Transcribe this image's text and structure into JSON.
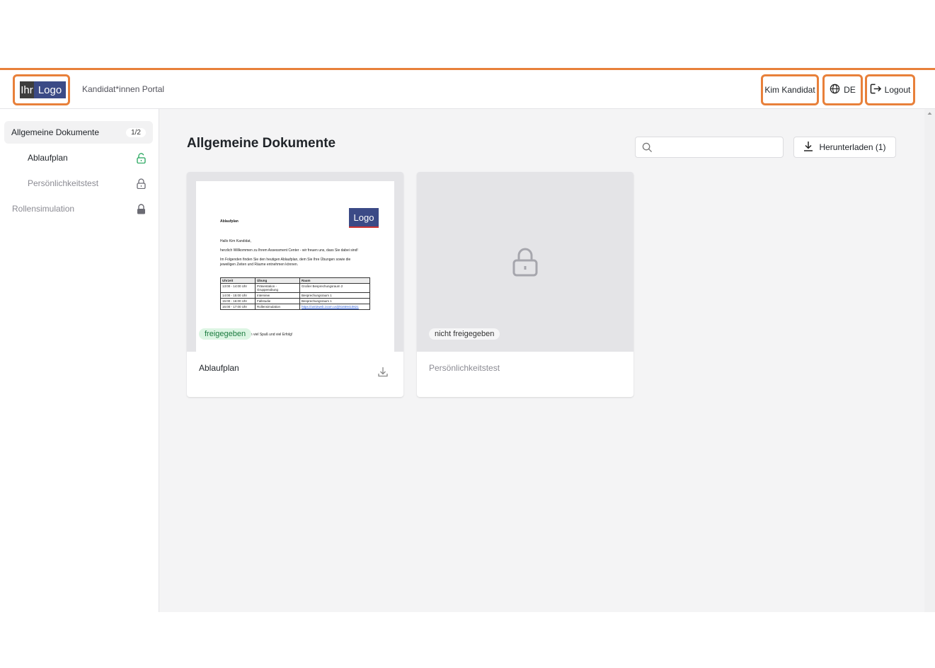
{
  "header": {
    "logo_part1": "Ihr",
    "logo_part2": "Logo",
    "portal_title": "Kandidat*innen Portal",
    "user_name": "Kim Kandidat",
    "language": "DE",
    "logout_label": "Logout"
  },
  "sidebar": {
    "items": [
      {
        "label": "Allgemeine Dokumente",
        "count": "1/2"
      },
      {
        "label": "Ablaufplan"
      },
      {
        "label": "Persönlichkeitstest"
      },
      {
        "label": "Rollensimulation"
      }
    ]
  },
  "main": {
    "title": "Allgemeine Dokumente",
    "search_value": "",
    "download_label": "Herunterladen (1)"
  },
  "cards": [
    {
      "title": "Ablaufplan",
      "status": "freigegeben",
      "preview": {
        "heading": "Ablaufplan",
        "logo": "Logo",
        "greeting": "Hallo Kim Kandidat,",
        "line1": "herzlich Willkommen zu Ihrem Assessment Center - wir freuen uns, dass Sie dabei sind!",
        "line2": "Im Folgenden finden Sie den heutigen Ablaufplan, dem Sie Ihre Übungen sowie die jeweiligen Zeiten und Räume entnehmen können.",
        "columns": [
          "Uhrzeit",
          "Übung",
          "Raum"
        ],
        "rows": [
          [
            "13:00 - 14:00 Uhr",
            "Präsentation - Gruppenübung",
            "Großer Besprechungsraum 2"
          ],
          [
            "14:00 - 15:00 Uhr",
            "Interview",
            "Besprechungsraum 1"
          ],
          [
            "15:00 - 16:00 Uhr",
            "Fallstudie",
            "Besprechungsraum 1"
          ],
          [
            "16:00 - 17:00 Uhr",
            "Rollensimulation",
            "https://us02web.zoom.us/j/81659410821"
          ]
        ],
        "footer": "en viel Spaß und viel Erfolg!"
      }
    },
    {
      "title": "Persönlichkeitstest",
      "status": "nicht freigegeben"
    }
  ],
  "colors": {
    "accent": "#e8803a",
    "unlocked": "#22a55a",
    "badge_green_bg": "#dcf5e3",
    "logo_blue": "#3b4a86"
  }
}
